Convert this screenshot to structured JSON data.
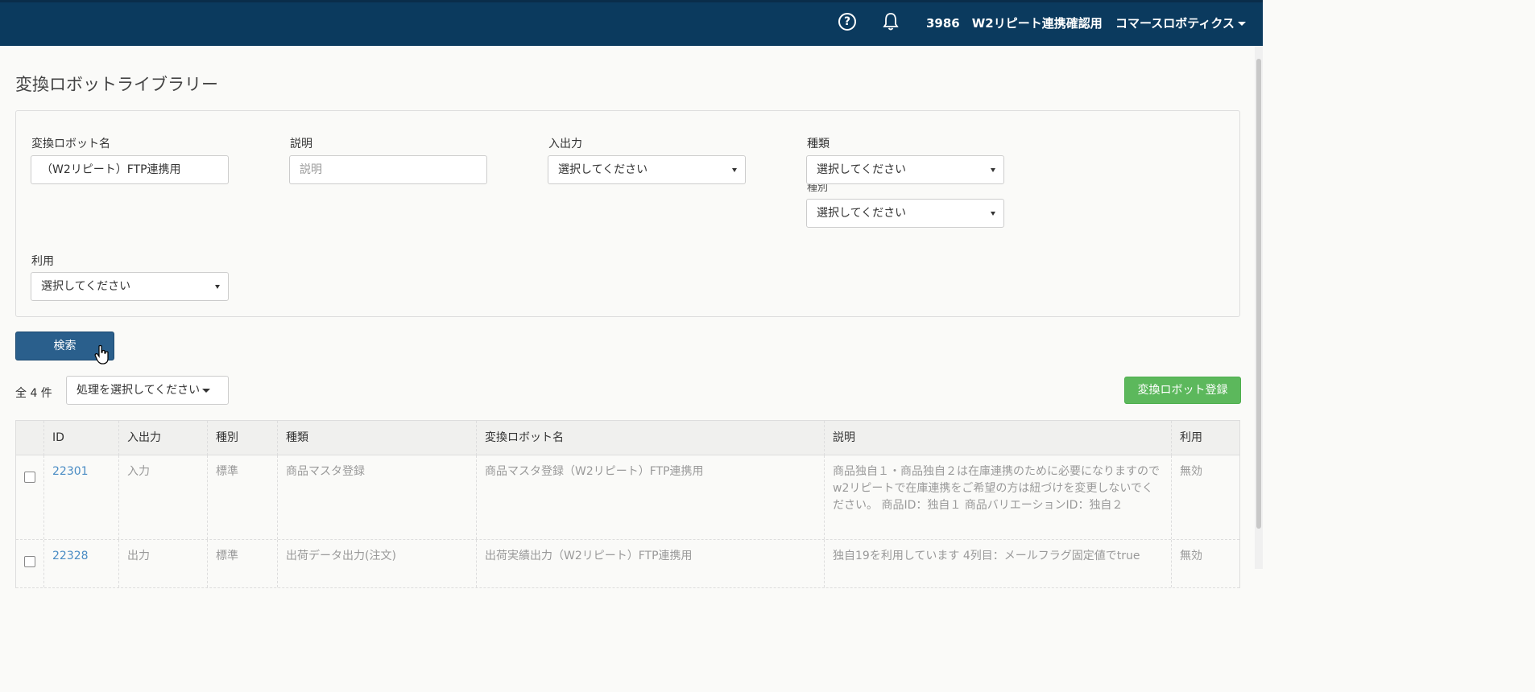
{
  "header": {
    "account": "3986　W2リピート連携確認用",
    "company": "コマースロボティクス",
    "help_icon": "question-circle-icon",
    "bell_icon": "bell-icon"
  },
  "page": {
    "title": "変換ロボットライブラリー"
  },
  "filters": {
    "robot_name_label": "変換ロボット名",
    "robot_name_value": "（W2リピート）FTP連携用",
    "description_label": "説明",
    "description_placeholder": "説明",
    "io_label": "入出力",
    "io_value": "選択してください",
    "kind_label": "種類",
    "kind_value": "選択してください",
    "type_label": "種別",
    "type_value": "選択してください",
    "usage_label": "利用",
    "usage_value": "選択してください"
  },
  "actions": {
    "search_label": "検索",
    "total": "全 4 件",
    "bulk_action": "処理を選択してください",
    "register_label": "変換ロボット登録"
  },
  "table": {
    "headers": [
      "ID",
      "入出力",
      "種別",
      "種類",
      "変換ロボット名",
      "説明",
      "利用"
    ],
    "rows": [
      {
        "id": "22301",
        "io": "入力",
        "type": "標準",
        "kind": "商品マスタ登録",
        "name": "商品マスタ登録（W2リピート）FTP連携用",
        "description": "商品独自１・商品独自２は在庫連携のために必要になりますので w2リピートで在庫連携をご希望の方は紐づけを変更しないでください。 商品ID：独自１ 商品バリエーションID：独自２",
        "usage": "無効"
      },
      {
        "id": "22328",
        "io": "出力",
        "type": "標準",
        "kind": "出荷データ出力(注文)",
        "name": "出荷実績出力（W2リピート）FTP連携用",
        "description": "独自19を利用しています 4列目：メールフラグ固定値でtrue",
        "usage": "無効"
      }
    ]
  }
}
